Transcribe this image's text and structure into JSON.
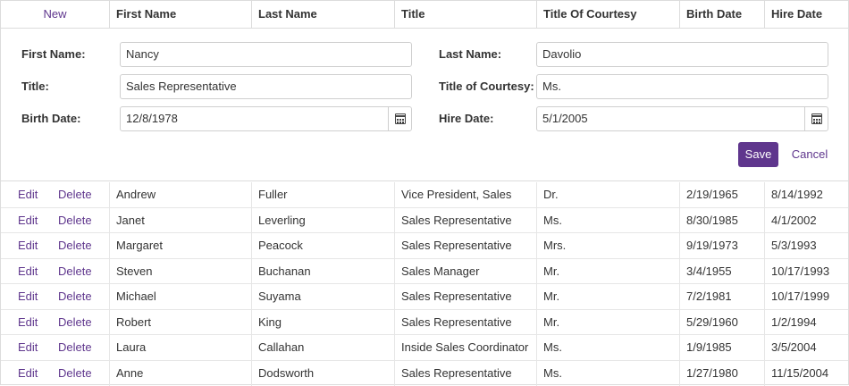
{
  "grid": {
    "new_label": "New",
    "columns": [
      "First Name",
      "Last Name",
      "Title",
      "Title Of Courtesy",
      "Birth Date",
      "Hire Date"
    ]
  },
  "form": {
    "first_name_label": "First Name:",
    "first_name_value": "Nancy",
    "last_name_label": "Last Name:",
    "last_name_value": "Davolio",
    "title_label": "Title:",
    "title_value": "Sales Representative",
    "courtesy_label": "Title of Courtesy:",
    "courtesy_value": "Ms.",
    "birth_label": "Birth Date:",
    "birth_value": "12/8/1978",
    "hire_label": "Hire Date:",
    "hire_value": "5/1/2005",
    "save_label": "Save",
    "cancel_label": "Cancel",
    "calendar_icon": "calendar-icon"
  },
  "commands": {
    "edit": "Edit",
    "delete": "Delete"
  },
  "rows": [
    [
      "Andrew",
      "Fuller",
      "Vice President, Sales",
      "Dr.",
      "2/19/1965",
      "8/14/1992"
    ],
    [
      "Janet",
      "Leverling",
      "Sales Representative",
      "Ms.",
      "8/30/1985",
      "4/1/2002"
    ],
    [
      "Margaret",
      "Peacock",
      "Sales Representative",
      "Mrs.",
      "9/19/1973",
      "5/3/1993"
    ],
    [
      "Steven",
      "Buchanan",
      "Sales Manager",
      "Mr.",
      "3/4/1955",
      "10/17/1993"
    ],
    [
      "Michael",
      "Suyama",
      "Sales Representative",
      "Mr.",
      "7/2/1981",
      "10/17/1999"
    ],
    [
      "Robert",
      "King",
      "Sales Representative",
      "Mr.",
      "5/29/1960",
      "1/2/1994"
    ],
    [
      "Laura",
      "Callahan",
      "Inside Sales Coordinator",
      "Ms.",
      "1/9/1985",
      "3/5/2004"
    ],
    [
      "Anne",
      "Dodsworth",
      "Sales Representative",
      "Ms.",
      "1/27/1980",
      "11/15/2004"
    ]
  ],
  "colors": {
    "accent": "#5f368d",
    "border": "#dcdcdc",
    "text": "#333333"
  }
}
